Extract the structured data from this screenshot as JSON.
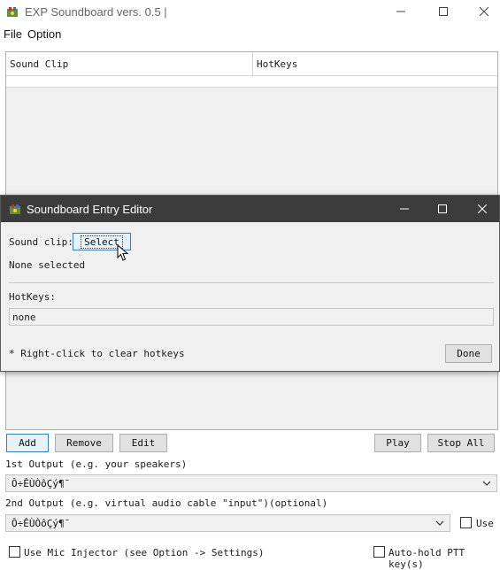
{
  "main_window": {
    "title": "EXP Soundboard vers. 0.5 |",
    "menu": [
      "File",
      "Option"
    ],
    "table_headers": [
      "Sound Clip",
      "HotKeys"
    ],
    "buttons": {
      "add": "Add",
      "remove": "Remove",
      "edit": "Edit",
      "play": "Play",
      "stop_all": "Stop All"
    },
    "output1_label": "1st Output (e.g. your speakers)",
    "output1_value": "Ô÷ÊÙÒôÇý¶¯",
    "output2_label": "2nd Output (e.g. virtual audio cable \"input\")(optional)",
    "output2_value": "Ô÷ÊÙÒôÇý¶¯",
    "use_label": "Use",
    "mic_injector_label": "Use Mic Injector (see Option -> Settings)",
    "auto_hold_label": "Auto-hold PTT key(s)"
  },
  "dialog": {
    "title": "Soundboard Entry Editor",
    "sound_clip_label": "Sound clip:",
    "select_button": "Select",
    "none_selected": "None selected",
    "hotkeys_label": "HotKeys:",
    "hotkeys_value": "none",
    "hint": "* Right-click to clear hotkeys",
    "done_button": "Done"
  },
  "icons": [
    "app-icon",
    "minimize-icon",
    "maximize-icon",
    "close-icon",
    "chevron-down-icon",
    "mouse-cursor-icon"
  ],
  "colors": {
    "dialog_titlebar": "#3c3c3c",
    "button_face": "#e1e1e1",
    "selected_border": "#3c7fb1"
  }
}
